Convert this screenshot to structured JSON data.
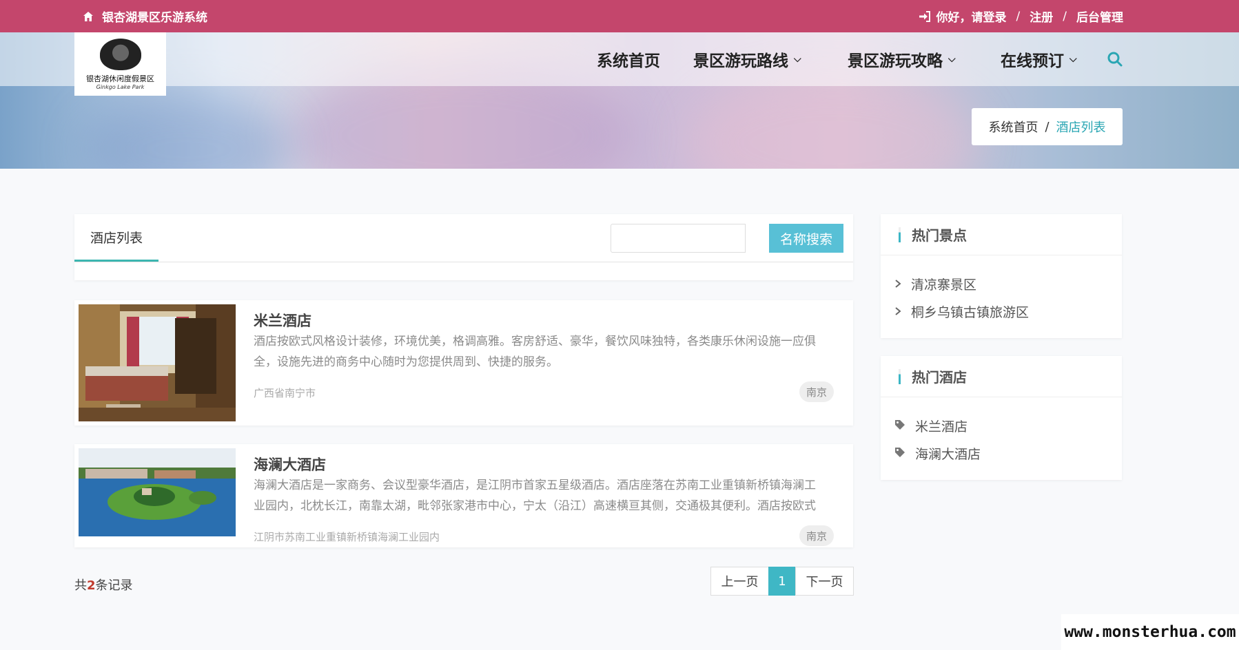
{
  "topbar": {
    "system_name": "银杏湖景区乐游系统",
    "greeting": "你好，请登录",
    "sep1": "/",
    "register": "注册",
    "sep2": "/",
    "admin": "后台管理"
  },
  "logo": {
    "text": "银杏湖休闲度假景区",
    "subtext": "Ginkgo Lake Park"
  },
  "nav": [
    {
      "label": "系统首页"
    },
    {
      "label": "景区游玩路线"
    },
    {
      "label": "景区游玩攻略"
    },
    {
      "label": "在线预订"
    }
  ],
  "breadcrumb": {
    "home": "系统首页",
    "sep": "/",
    "current": "酒店列表"
  },
  "list": {
    "tab_label": "酒店列表",
    "search_placeholder": "",
    "search_button": "名称搜索"
  },
  "hotels": [
    {
      "name": "米兰酒店",
      "desc_line1": "酒店按欧式风格设计装修，环境优美，格调高雅。客房舒适、豪华，餐饮风味独特，各类康乐休闲设施一应俱",
      "desc_line2": "全，设施先进的商务中心随时为您提供周到、快捷的服务。",
      "address": "广西省南宁市",
      "tag": "南京"
    },
    {
      "name": "海澜大酒店",
      "desc_line1": "海澜大酒店是一家商务、会议型豪华酒店，是江阴市首家五星级酒店。酒店座落在苏南工业重镇新桥镇海澜工",
      "desc_line2": "业园内，北枕长江，南靠太湖，毗邻张家港市中心，宁太（沿江）高速横亘其侧，交通极其便利。酒店按欧式",
      "address": "江阴市苏南工业重镇新桥镇海澜工业园内",
      "tag": "南京"
    }
  ],
  "footer": {
    "count_prefix": "共",
    "count_value": "2",
    "count_suffix": "条记录",
    "prev": "上一页",
    "page": "1",
    "next": "下一页"
  },
  "sidebar": {
    "hot_spots_title": "热门景点",
    "hot_spots": [
      "清凉寨景区",
      "桐乡乌镇古镇旅游区"
    ],
    "hot_hotels_title": "热门酒店",
    "hot_hotels": [
      "米兰酒店",
      "海澜大酒店"
    ]
  },
  "watermark": "www.monsterhua.com"
}
